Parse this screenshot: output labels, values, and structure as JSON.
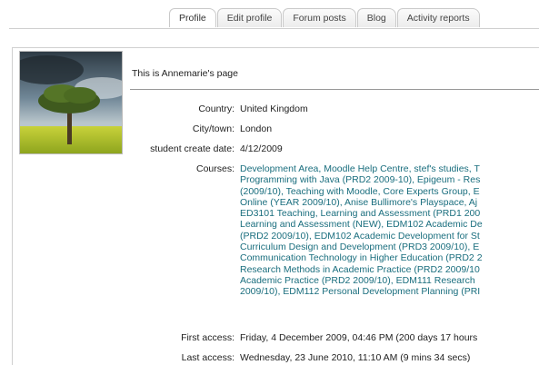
{
  "tabs": [
    {
      "label": "Profile"
    },
    {
      "label": "Edit profile"
    },
    {
      "label": "Forum posts"
    },
    {
      "label": "Blog"
    },
    {
      "label": "Activity reports"
    }
  ],
  "profile": {
    "intro": "This is Annemarie's page",
    "country_label": "Country:",
    "country": "United Kingdom",
    "city_label": "City/town:",
    "city": "London",
    "create_label": "student create date:",
    "create_date": "4/12/2009",
    "courses_label": "Courses:",
    "course_lines": [
      "Development Area, Moodle Help Centre, stef's studies, T",
      "Programming with Java (PRD2 2009-10), Epigeum - Res",
      "(2009/10), Teaching with Moodle, Core Experts Group, E",
      "Online (YEAR 2009/10), Anise Bullimore's Playspace, Aj",
      "ED3101 Teaching, Learning and Assessment (PRD1 200",
      "Learning and Assessment (NEW), EDM102 Academic De",
      "(PRD2 2009/10), EDM102 Academic Development for St",
      "Curriculum Design and Development (PRD3 2009/10), E",
      "Communication Technology in Higher Education (PRD2 2",
      "Research Methods in Academic Practice (PRD2 2009/10",
      "Academic Practice (PRD2 2009/10), EDM111 Research",
      "2009/10), EDM112 Personal Development Planning (PRI"
    ],
    "first_access_label": "First access:",
    "first_access": "Friday, 4 December 2009, 04:46 PM  (200 days 17 hours",
    "last_access_label": "Last access:",
    "last_access": "Wednesday, 23 June 2010, 11:10 AM  (9 mins 34 secs)"
  },
  "colors": {
    "link": "#1a6e7e",
    "text": "#222222",
    "border": "#cfcfcf"
  },
  "icons": {
    "photo": "tree-photo"
  }
}
